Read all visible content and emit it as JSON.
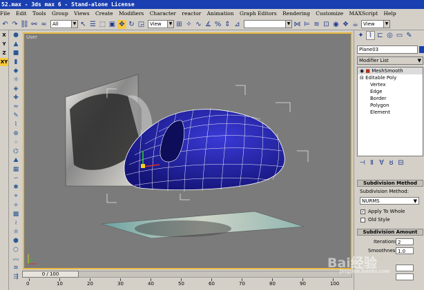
{
  "title": "52.max - 3ds max 6 - Stand-alone License",
  "menu": [
    "File",
    "Edit",
    "Tools",
    "Group",
    "Views",
    "Create",
    "Modifiers",
    "Character",
    "reactor",
    "Animation",
    "Graph Editors",
    "Rendering",
    "Customize",
    "MAXScript",
    "Help"
  ],
  "toolbar": {
    "selection_filter": "All",
    "ref_coord": "View",
    "named_sel": "",
    "view_right": "View"
  },
  "axes": [
    "X",
    "Y",
    "Z",
    "XY"
  ],
  "viewport": {
    "label": "User"
  },
  "panel": {
    "object_name": "Plane03",
    "modifier_list": "Modifier List",
    "stack": [
      {
        "label": "MeshSmooth",
        "selected": true
      },
      {
        "label": "Editable Poly",
        "selected": false
      },
      {
        "label": "Vertex",
        "selected": false
      },
      {
        "label": "Edge",
        "selected": false
      },
      {
        "label": "Border",
        "selected": false
      },
      {
        "label": "Polygon",
        "selected": false
      },
      {
        "label": "Element",
        "selected": false
      }
    ],
    "rollout1": "Subdivision Method",
    "subdiv_label": "Subdivision Method:",
    "subdiv_value": "NURMS",
    "apply_whole": "Apply To Whole",
    "apply_whole_checked": true,
    "old_style": "Old Style",
    "old_style_checked": false,
    "rollout2": "Subdivision Amount",
    "iterations_label": "Iterations:",
    "iterations_value": "2",
    "smoothness_label": "Smoothness:",
    "smoothness_value": "1.0"
  },
  "timeline": {
    "slider": "0 / 100",
    "ticks": [
      "0",
      "10",
      "20",
      "30",
      "40",
      "50",
      "60",
      "70",
      "80",
      "90",
      "100"
    ]
  },
  "watermark": {
    "main": "Bai经验",
    "sub": "jingyan.baidu.com"
  }
}
